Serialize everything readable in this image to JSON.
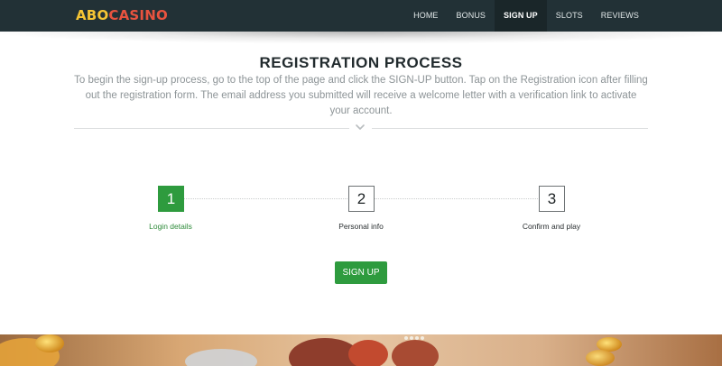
{
  "brand": {
    "logo_part_1": "ABO",
    "logo_part_2": "CASINO"
  },
  "nav": {
    "items": [
      "HOME",
      "BONUS",
      "SIGN UP",
      "SLOTS",
      "REVIEWS"
    ],
    "active": "SIGN UP"
  },
  "main": {
    "title": "REGISTRATION PROCESS",
    "intro": "To begin the sign-up process, go to the top of the page and click the SIGN-UP button. Tap on the Registration icon after filling out the registration form. The email address you submitted will receive a welcome letter with a verification link to activate your account."
  },
  "steps": [
    {
      "number": "1",
      "label": "Login details",
      "state": "current"
    },
    {
      "number": "2",
      "label": "Personal info",
      "state": "pending"
    },
    {
      "number": "3",
      "label": "Confirm and play",
      "state": "pending"
    }
  ],
  "cta": {
    "label": "SIGN UP"
  },
  "colors": {
    "nav_bg": "#223136",
    "accent_green": "#2e9b3e",
    "logo_yellow": "#f6c534",
    "logo_red": "#e8533f"
  },
  "icons": {
    "divider": "chevron-down-icon"
  }
}
